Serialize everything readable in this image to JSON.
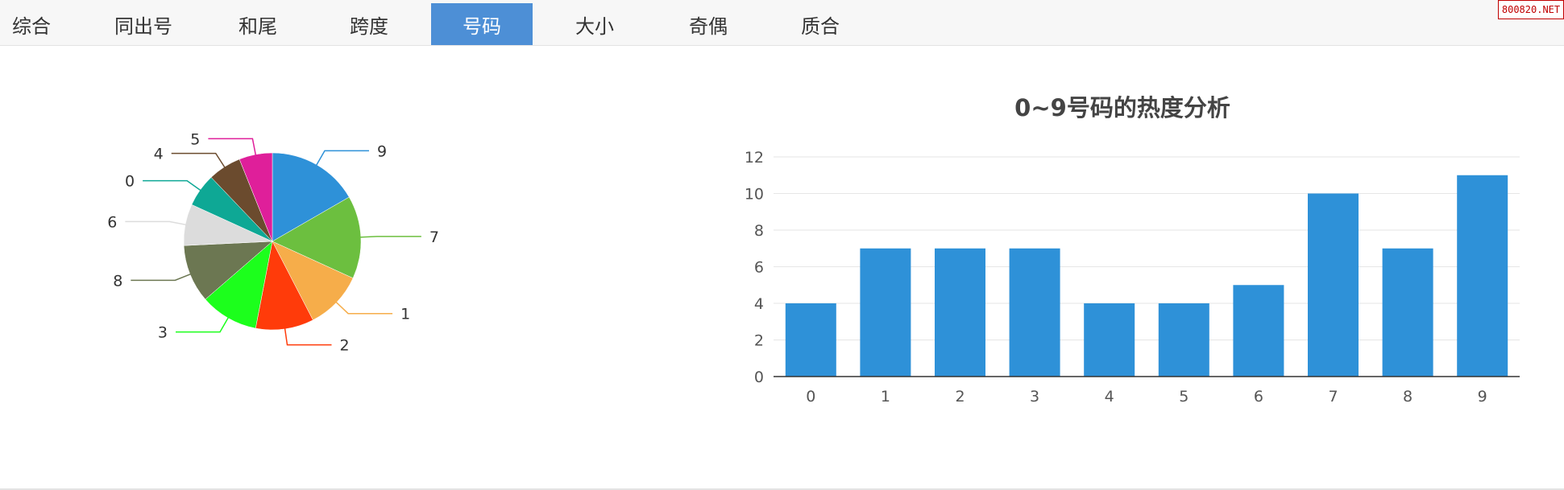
{
  "tabs": [
    {
      "label": "综合",
      "active": false
    },
    {
      "label": "同出号",
      "active": false
    },
    {
      "label": "和尾",
      "active": false
    },
    {
      "label": "跨度",
      "active": false
    },
    {
      "label": "号码",
      "active": true
    },
    {
      "label": "大小",
      "active": false
    },
    {
      "label": "奇偶",
      "active": false
    },
    {
      "label": "质合",
      "active": false
    }
  ],
  "watermark": "800820.NET",
  "chart_data": [
    {
      "type": "pie",
      "title": "",
      "slices": [
        {
          "label": "9",
          "value": 11,
          "color": "#2e91d8"
        },
        {
          "label": "7",
          "value": 10,
          "color": "#6cbf3f"
        },
        {
          "label": "1",
          "value": 7,
          "color": "#f6ad4a"
        },
        {
          "label": "2",
          "value": 7,
          "color": "#ff3b0a"
        },
        {
          "label": "3",
          "value": 7,
          "color": "#1cff1c"
        },
        {
          "label": "8",
          "value": 7,
          "color": "#6c7752"
        },
        {
          "label": "6",
          "value": 5,
          "color": "#dcdcdc"
        },
        {
          "label": "0",
          "value": 4,
          "color": "#0ea895"
        },
        {
          "label": "4",
          "value": 4,
          "color": "#6b4b2e"
        },
        {
          "label": "5",
          "value": 4,
          "color": "#df1f9a"
        }
      ]
    },
    {
      "type": "bar",
      "title": "0~9号码的热度分析",
      "categories": [
        "0",
        "1",
        "2",
        "3",
        "4",
        "5",
        "6",
        "7",
        "8",
        "9"
      ],
      "values": [
        4,
        7,
        7,
        7,
        4,
        4,
        5,
        10,
        7,
        11
      ],
      "ylim": [
        0,
        12
      ],
      "yticks": [
        "0",
        "2",
        "4",
        "6",
        "8",
        "10",
        "12"
      ],
      "bar_color": "#2e91d8",
      "grid": true
    }
  ]
}
